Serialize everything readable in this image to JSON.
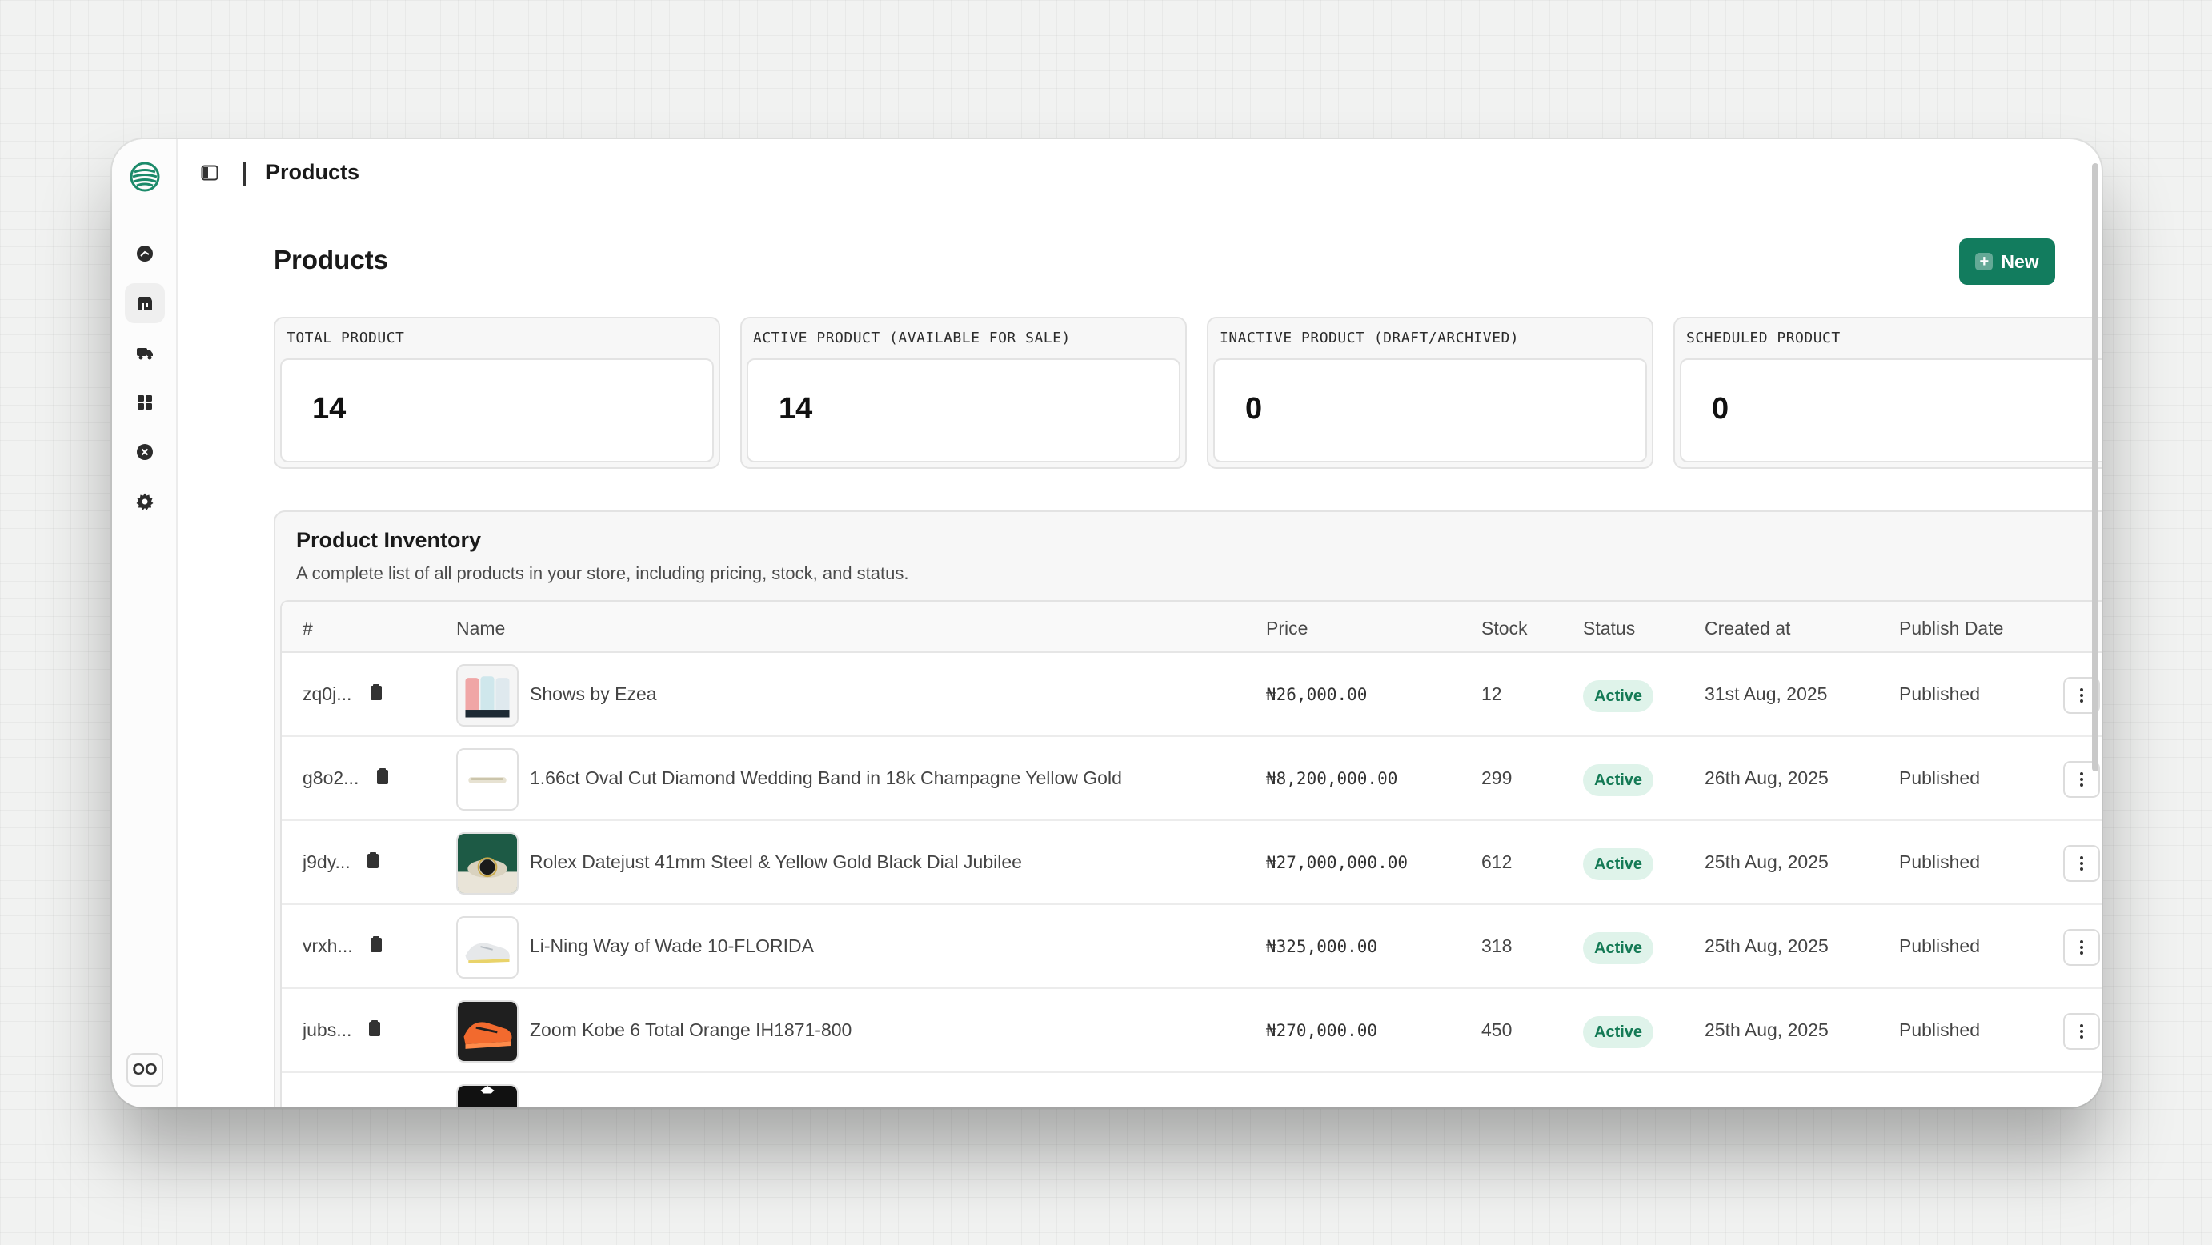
{
  "app": {
    "breadcrumb_title": "Products"
  },
  "sidebar": {
    "items": [
      {
        "icon": "dashboard-icon"
      },
      {
        "icon": "store-icon",
        "active": true
      },
      {
        "icon": "delivery-truck-icon"
      },
      {
        "icon": "grid-icon"
      },
      {
        "icon": "cancel-circle-icon"
      },
      {
        "icon": "gear-icon"
      }
    ],
    "bottom_label": "OO"
  },
  "page": {
    "title": "Products",
    "new_button_label": "New"
  },
  "stats": [
    {
      "label": "TOTAL PRODUCT",
      "value": "14"
    },
    {
      "label": "ACTIVE PRODUCT (AVAILABLE FOR SALE)",
      "value": "14"
    },
    {
      "label": "INACTIVE PRODUCT (DRAFT/ARCHIVED)",
      "value": "0"
    },
    {
      "label": "SCHEDULED PRODUCT",
      "value": "0"
    }
  ],
  "inventory": {
    "title": "Product Inventory",
    "description": "A complete list of all products in your store, including pricing, stock, and status.",
    "columns": [
      "#",
      "Name",
      "Price",
      "Stock",
      "Status",
      "Created at",
      "Publish Date"
    ],
    "rows": [
      {
        "id": "zq0j...",
        "name": "Shows by Ezea",
        "price": "₦26,000.00",
        "stock": "12",
        "status": "Active",
        "created": "31st Aug, 2025",
        "publish": "Published"
      },
      {
        "id": "g8o2...",
        "name": "1.66ct Oval Cut Diamond Wedding Band in 18k Champagne Yellow Gold",
        "price": "₦8,200,000.00",
        "stock": "299",
        "status": "Active",
        "created": "26th Aug, 2025",
        "publish": "Published"
      },
      {
        "id": "j9dy...",
        "name": "Rolex Datejust 41mm Steel & Yellow Gold Black Dial Jubilee",
        "price": "₦27,000,000.00",
        "stock": "612",
        "status": "Active",
        "created": "25th Aug, 2025",
        "publish": "Published"
      },
      {
        "id": "vrxh...",
        "name": "Li-Ning Way of Wade 10-FLORIDA",
        "price": "₦325,000.00",
        "stock": "318",
        "status": "Active",
        "created": "25th Aug, 2025",
        "publish": "Published"
      },
      {
        "id": "jubs...",
        "name": "Zoom Kobe 6 Total Orange IH1871-800",
        "price": "₦270,000.00",
        "stock": "450",
        "status": "Active",
        "created": "25th Aug, 2025",
        "publish": "Published"
      }
    ]
  },
  "colors": {
    "accent": "#127c5e",
    "badge_bg": "#dff3ea",
    "badge_text": "#147a55"
  }
}
